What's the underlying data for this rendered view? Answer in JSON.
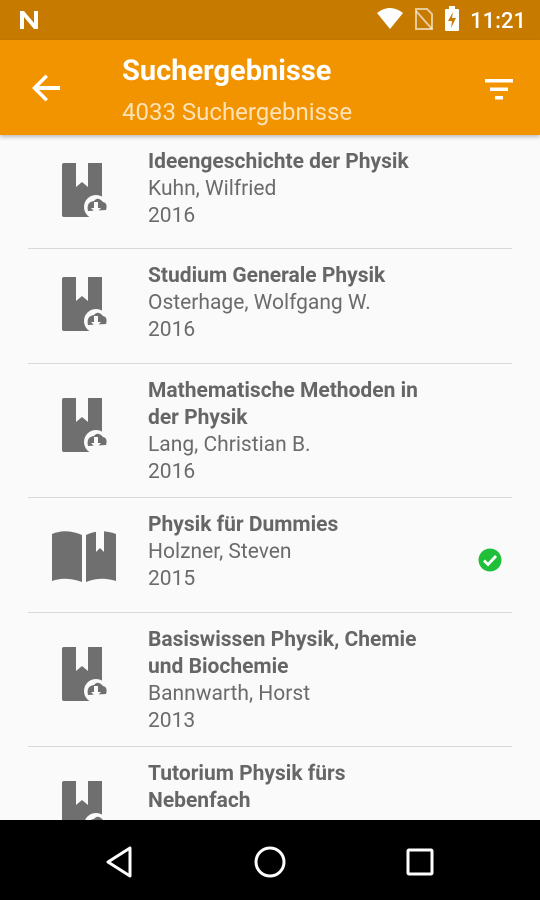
{
  "status_bar": {
    "time": "11:21"
  },
  "app_bar": {
    "title": "Suchergebnisse",
    "subtitle": "4033 Suchergebnisse"
  },
  "colors": {
    "primary": "#f29400",
    "status_bar": "#c77a00",
    "check": "#1fbf3a"
  },
  "results": [
    {
      "title_lines": [
        "Ideengeschichte der Physik"
      ],
      "author": "Kuhn, Wilfried",
      "year": "2016",
      "icon": "ebook-download-icon",
      "available": false
    },
    {
      "title_lines": [
        "Studium Generale Physik"
      ],
      "author": "Osterhage, Wolfgang W.",
      "year": "2016",
      "icon": "ebook-download-icon",
      "available": false
    },
    {
      "title_lines": [
        "Mathematische Methoden in",
        "der Physik"
      ],
      "author": "Lang, Christian B.",
      "year": "2016",
      "icon": "ebook-download-icon",
      "available": false
    },
    {
      "title_lines": [
        "Physik für Dummies"
      ],
      "author": "Holzner, Steven",
      "year": "2015",
      "icon": "open-book-icon",
      "available": true
    },
    {
      "title_lines": [
        "Basiswissen Physik, Chemie",
        "und Biochemie"
      ],
      "author": "Bannwarth, Horst",
      "year": "2013",
      "icon": "ebook-download-icon",
      "available": false
    },
    {
      "title_lines": [
        "Tutorium Physik fürs",
        "Nebenfach"
      ],
      "author": "",
      "year": "",
      "icon": "ebook-download-icon",
      "available": false
    }
  ]
}
